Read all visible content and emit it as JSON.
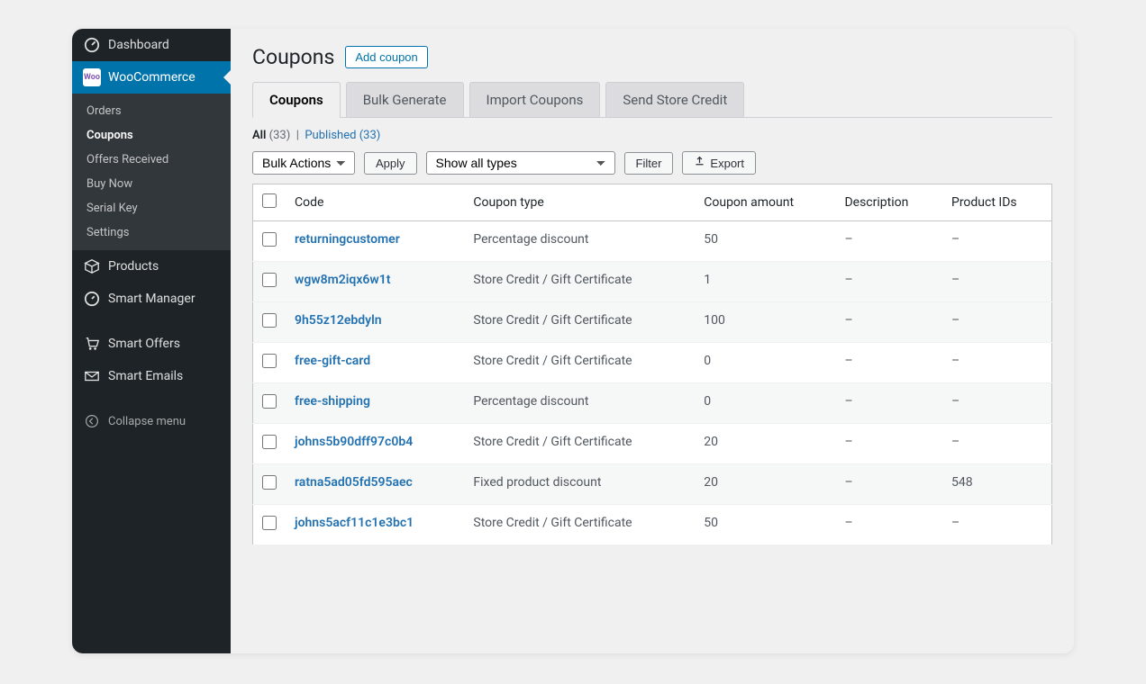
{
  "sidebar": {
    "dashboard": "Dashboard",
    "woocommerce": "WooCommerce",
    "sub": {
      "orders": "Orders",
      "coupons": "Coupons",
      "offers": "Offers Received",
      "buynow": "Buy Now",
      "serial": "Serial Key",
      "settings": "Settings"
    },
    "products": "Products",
    "smart_manager": "Smart Manager",
    "smart_offers": "Smart Offers",
    "smart_emails": "Smart Emails",
    "collapse": "Collapse menu"
  },
  "header": {
    "title": "Coupons",
    "add": "Add coupon"
  },
  "tabs": {
    "coupons": "Coupons",
    "bulk": "Bulk Generate",
    "import": "Import Coupons",
    "credit": "Send Store Credit"
  },
  "views": {
    "all_label": "All",
    "all_count": "(33)",
    "sep": "|",
    "published_label": "Published",
    "published_count": "(33)"
  },
  "toolbar": {
    "bulk": "Bulk Actions",
    "apply": "Apply",
    "types": "Show all types",
    "filter": "Filter",
    "export": "Export"
  },
  "columns": {
    "code": "Code",
    "type": "Coupon type",
    "amount": "Coupon amount",
    "desc": "Description",
    "pids": "Product IDs"
  },
  "rows": [
    {
      "code": "returningcustomer",
      "type": "Percentage discount",
      "amount": "50",
      "desc": "–",
      "pids": "–"
    },
    {
      "code": "wgw8m2iqx6w1t",
      "type": "Store Credit / Gift Certificate",
      "amount": "1",
      "desc": "–",
      "pids": "–"
    },
    {
      "code": "9h55z12ebdyln",
      "type": "Store Credit / Gift Certificate",
      "amount": "100",
      "desc": "–",
      "pids": "–"
    },
    {
      "code": "free-gift-card",
      "type": "Store Credit / Gift Certificate",
      "amount": "0",
      "desc": "–",
      "pids": "–"
    },
    {
      "code": "free-shipping",
      "type": "Percentage discount",
      "amount": "0",
      "desc": "–",
      "pids": "–"
    },
    {
      "code": "johns5b90dff97c0b4",
      "type": "Store Credit / Gift Certificate",
      "amount": "20",
      "desc": "–",
      "pids": "–"
    },
    {
      "code": "ratna5ad05fd595aec",
      "type": "Fixed product discount",
      "amount": "20",
      "desc": "–",
      "pids": "548"
    },
    {
      "code": "johns5acf11c1e3bc1",
      "type": "Store Credit / Gift Certificate",
      "amount": "50",
      "desc": "–",
      "pids": "–"
    }
  ]
}
